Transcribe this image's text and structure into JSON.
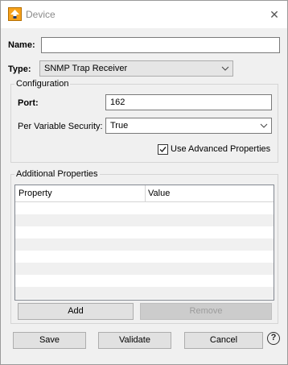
{
  "window": {
    "title": "Device"
  },
  "form": {
    "name_label": "Name:",
    "name_value": "",
    "type_label": "Type:",
    "type_value": "SNMP Trap Receiver"
  },
  "configuration": {
    "title": "Configuration",
    "port_label": "Port:",
    "port_value": "162",
    "security_label": "Per Variable Security:",
    "security_value": "True",
    "advanced_label": "Use Advanced Properties",
    "advanced_checked": true
  },
  "additional": {
    "title": "Additional Properties",
    "columns": [
      "Property",
      "Value"
    ],
    "add_label": "Add",
    "remove_label": "Remove"
  },
  "footer": {
    "save_label": "Save",
    "validate_label": "Validate",
    "cancel_label": "Cancel",
    "help_label": "?"
  },
  "icons": {
    "app": "app-logo-icon",
    "close": "close-icon",
    "chevron": "chevron-down-icon",
    "check": "checkmark-icon",
    "help": "help-icon"
  },
  "colors": {
    "app_icon": "#f7a21b",
    "window_bg": "#f0f0f0",
    "title_text": "#8a8a8a"
  }
}
